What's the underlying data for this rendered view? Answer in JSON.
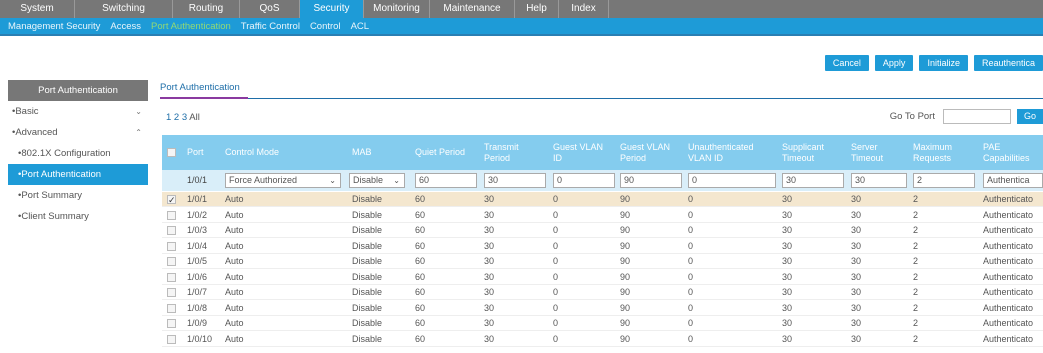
{
  "topnav": [
    "System",
    "Switching",
    "Routing",
    "QoS",
    "Security",
    "Monitoring",
    "Maintenance",
    "Help",
    "Index"
  ],
  "topnav_active": "Security",
  "subnav": [
    "Management Security",
    "Access",
    "Port Authentication",
    "Traffic Control",
    "Control",
    "ACL"
  ],
  "subnav_active": "Port Authentication",
  "actions": [
    "Cancel",
    "Apply",
    "Initialize",
    "Reauthentica"
  ],
  "sidebar": {
    "title": "Port Authentication",
    "basic": "Basic",
    "advanced": "Advanced",
    "items": [
      "802.1X Configuration",
      "Port Authentication",
      "Port Summary",
      "Client Summary"
    ],
    "active_index": 1
  },
  "content": {
    "tab": "Port Authentication",
    "pager": {
      "pages": "1 2 3",
      "all": "All"
    },
    "goto_label": "Go To Port",
    "go_button": "Go"
  },
  "columns": [
    "Port",
    "Control Mode",
    "MAB",
    "Quiet Period",
    "Transmit Period",
    "Guest VLAN ID",
    "Guest VLAN Period",
    "Unauthenticated VLAN ID",
    "Supplicant Timeout",
    "Server Timeout",
    "Maximum Requests",
    "PAE Capabilities"
  ],
  "edit_row": {
    "port": "1/0/1",
    "control_mode": "Force Authorized",
    "mab": "Disable",
    "quiet_period": "60",
    "transmit_period": "30",
    "guest_vlan_id": "0",
    "guest_vlan_period": "90",
    "unauth_vlan_id": "0",
    "supplicant_timeout": "30",
    "server_timeout": "30",
    "max_requests": "2",
    "pae": "Authentica"
  },
  "rows": [
    [
      "1/0/1",
      "Auto",
      "Disable",
      "60",
      "30",
      "0",
      "90",
      "0",
      "30",
      "30",
      "2",
      "Authenticato"
    ],
    [
      "1/0/2",
      "Auto",
      "Disable",
      "60",
      "30",
      "0",
      "90",
      "0",
      "30",
      "30",
      "2",
      "Authenticato"
    ],
    [
      "1/0/3",
      "Auto",
      "Disable",
      "60",
      "30",
      "0",
      "90",
      "0",
      "30",
      "30",
      "2",
      "Authenticato"
    ],
    [
      "1/0/4",
      "Auto",
      "Disable",
      "60",
      "30",
      "0",
      "90",
      "0",
      "30",
      "30",
      "2",
      "Authenticato"
    ],
    [
      "1/0/5",
      "Auto",
      "Disable",
      "60",
      "30",
      "0",
      "90",
      "0",
      "30",
      "30",
      "2",
      "Authenticato"
    ],
    [
      "1/0/6",
      "Auto",
      "Disable",
      "60",
      "30",
      "0",
      "90",
      "0",
      "30",
      "30",
      "2",
      "Authenticato"
    ],
    [
      "1/0/7",
      "Auto",
      "Disable",
      "60",
      "30",
      "0",
      "90",
      "0",
      "30",
      "30",
      "2",
      "Authenticato"
    ],
    [
      "1/0/8",
      "Auto",
      "Disable",
      "60",
      "30",
      "0",
      "90",
      "0",
      "30",
      "30",
      "2",
      "Authenticato"
    ],
    [
      "1/0/9",
      "Auto",
      "Disable",
      "60",
      "30",
      "0",
      "90",
      "0",
      "30",
      "30",
      "2",
      "Authenticato"
    ],
    [
      "1/0/10",
      "Auto",
      "Disable",
      "60",
      "30",
      "0",
      "90",
      "0",
      "30",
      "30",
      "2",
      "Authenticato"
    ]
  ],
  "selected_row": 0
}
